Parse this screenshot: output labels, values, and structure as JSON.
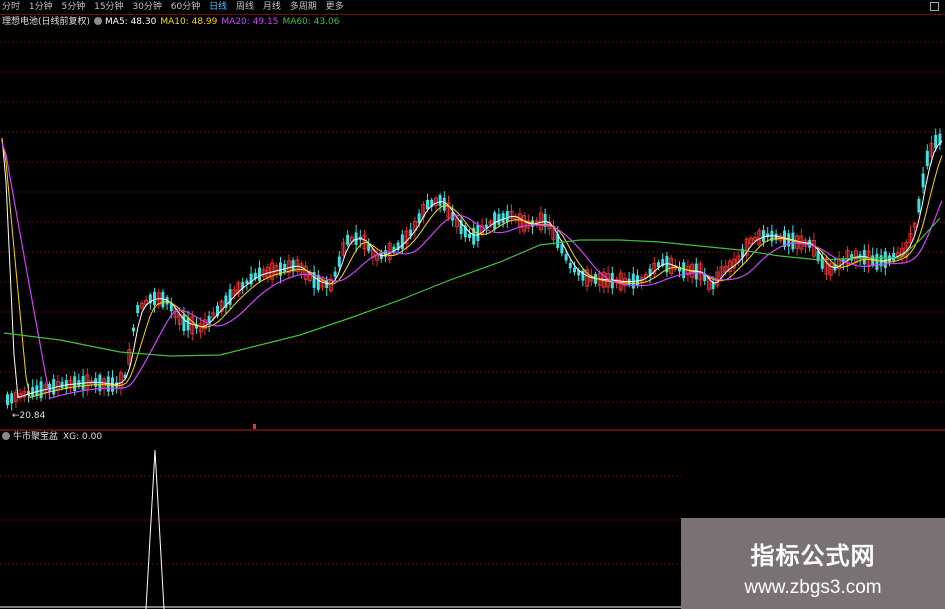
{
  "toolbar": {
    "tabs": [
      "分时",
      "1分钟",
      "5分钟",
      "15分钟",
      "30分钟",
      "60分钟",
      "日线",
      "周线",
      "月线",
      "多周期",
      "更多"
    ],
    "active_tab": "日线"
  },
  "legend": {
    "title": "理想电池(日线前复权)",
    "ma5": "MA5: 48.30",
    "ma10": "MA10: 48.99",
    "ma20": "MA20: 49.15",
    "ma60": "MA60: 43.06",
    "colors": {
      "ma5": "#ffffff",
      "ma10": "#ffd700",
      "ma20": "#d040ff",
      "ma60": "#40c040"
    }
  },
  "price_panel": {
    "low_label": "20.84"
  },
  "indicator": {
    "title": "牛市聚宝盆",
    "xg_value": "XG: 0.00"
  },
  "watermark": {
    "line1": "指标公式网",
    "line2": "www.zbgs3.com"
  },
  "colors": {
    "up": "#e03030",
    "down": "#40e0e0",
    "grid": "#5a0a0a",
    "separator": "#b02020"
  }
}
